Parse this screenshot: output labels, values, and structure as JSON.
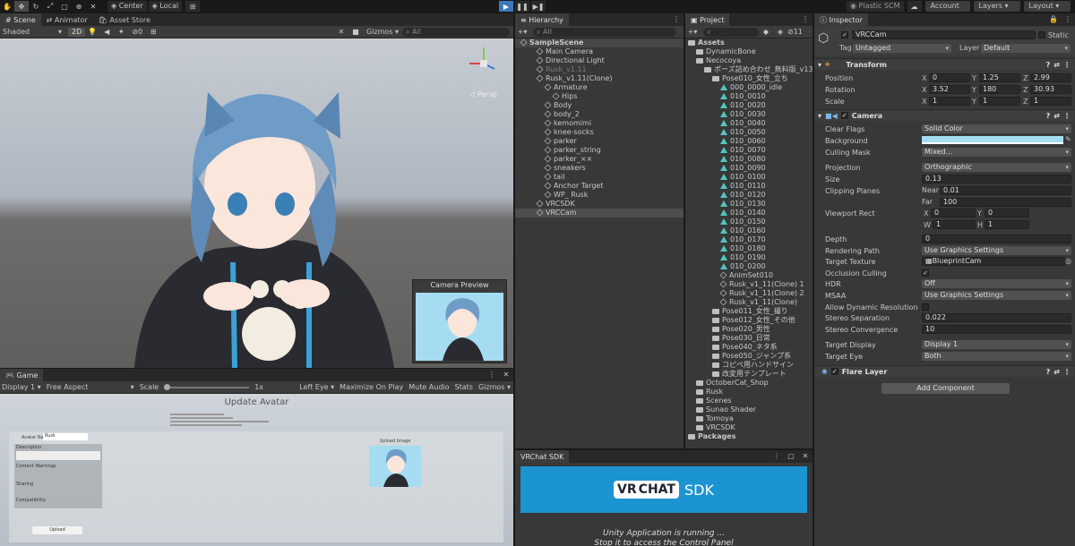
{
  "toolbar": {
    "center_label": "Center",
    "local_label": "Local",
    "plastic_label": "Plastic SCM",
    "account_label": "Account",
    "layers_label": "Layers",
    "layout_label": "Layout"
  },
  "scene": {
    "tabs": [
      "Scene",
      "Animator",
      "Asset Store"
    ],
    "shading": "Shaded",
    "mode_2d": "2D",
    "gizmos": "Gizmos",
    "search_placeholder": "All",
    "hidden_count": "0",
    "persp_label": "Persp",
    "camera_preview_title": "Camera Preview"
  },
  "game": {
    "tab": "Game",
    "display": "Display 1",
    "aspect": "Free Aspect",
    "scale_label": "Scale",
    "scale_value": "1x",
    "eye": "Left Eye",
    "maximize": "Maximize On Play",
    "mute": "Mute Audio",
    "stats": "Stats",
    "gizmos": "Gizmos",
    "upload_title": "Update Avatar",
    "avatar_name_label": "Avatar Name",
    "avatar_name_value": "Rusk",
    "description_label": "Description",
    "content_warnings_label": "Content Warnings",
    "sharing_label": "Sharing",
    "compatibility_label": "Compatibility",
    "upload_image_label": "Upload Image",
    "upload_button": "Upload"
  },
  "hierarchy": {
    "tab": "Hierarchy",
    "search_placeholder": "All",
    "items": [
      {
        "label": "SampleScene",
        "indent": 0,
        "kind": "scene"
      },
      {
        "label": "Main Camera",
        "indent": 2,
        "kind": "obj"
      },
      {
        "label": "Directional Light",
        "indent": 2,
        "kind": "obj"
      },
      {
        "label": "Rusk_v1.11",
        "indent": 2,
        "kind": "dim"
      },
      {
        "label": "Rusk_v1.11(Clone)",
        "indent": 2,
        "kind": "obj"
      },
      {
        "label": "Armature",
        "indent": 3,
        "kind": "obj"
      },
      {
        "label": "Hips",
        "indent": 4,
        "kind": "obj"
      },
      {
        "label": "Body",
        "indent": 3,
        "kind": "obj"
      },
      {
        "label": "body_2",
        "indent": 3,
        "kind": "obj"
      },
      {
        "label": "kemomimi",
        "indent": 3,
        "kind": "obj"
      },
      {
        "label": "knee-socks",
        "indent": 3,
        "kind": "obj"
      },
      {
        "label": "parker",
        "indent": 3,
        "kind": "obj"
      },
      {
        "label": "parker_string",
        "indent": 3,
        "kind": "obj"
      },
      {
        "label": "parker_××",
        "indent": 3,
        "kind": "obj"
      },
      {
        "label": "sneakers",
        "indent": 3,
        "kind": "obj"
      },
      {
        "label": "tail",
        "indent": 3,
        "kind": "obj"
      },
      {
        "label": "Anchor Target",
        "indent": 3,
        "kind": "obj"
      },
      {
        "label": "WP_ Rusk",
        "indent": 3,
        "kind": "obj"
      },
      {
        "label": "VRCSDK",
        "indent": 2,
        "kind": "obj"
      },
      {
        "label": "VRCCam",
        "indent": 2,
        "kind": "selected"
      }
    ]
  },
  "project": {
    "tab": "Project",
    "count": "11",
    "items": [
      {
        "label": "Assets",
        "indent": 0,
        "kind": "folder"
      },
      {
        "label": "DynamicBone",
        "indent": 1,
        "kind": "folder"
      },
      {
        "label": "Necocoya",
        "indent": 1,
        "kind": "folder"
      },
      {
        "label": "ポーズ詰め合わせ_無料版_v130",
        "indent": 2,
        "kind": "folder"
      },
      {
        "label": "Pose010_女性_立ち",
        "indent": 3,
        "kind": "folder"
      },
      {
        "label": "000_0000_idle",
        "indent": 4,
        "kind": "anim"
      },
      {
        "label": "010_0010",
        "indent": 4,
        "kind": "anim"
      },
      {
        "label": "010_0020",
        "indent": 4,
        "kind": "anim"
      },
      {
        "label": "010_0030",
        "indent": 4,
        "kind": "anim"
      },
      {
        "label": "010_0040",
        "indent": 4,
        "kind": "anim"
      },
      {
        "label": "010_0050",
        "indent": 4,
        "kind": "anim"
      },
      {
        "label": "010_0060",
        "indent": 4,
        "kind": "anim"
      },
      {
        "label": "010_0070",
        "indent": 4,
        "kind": "anim"
      },
      {
        "label": "010_0080",
        "indent": 4,
        "kind": "anim"
      },
      {
        "label": "010_0090",
        "indent": 4,
        "kind": "anim"
      },
      {
        "label": "010_0100",
        "indent": 4,
        "kind": "anim"
      },
      {
        "label": "010_0110",
        "indent": 4,
        "kind": "anim"
      },
      {
        "label": "010_0120",
        "indent": 4,
        "kind": "anim"
      },
      {
        "label": "010_0130",
        "indent": 4,
        "kind": "anim"
      },
      {
        "label": "010_0140",
        "indent": 4,
        "kind": "anim"
      },
      {
        "label": "010_0150",
        "indent": 4,
        "kind": "anim"
      },
      {
        "label": "010_0160",
        "indent": 4,
        "kind": "anim"
      },
      {
        "label": "010_0170",
        "indent": 4,
        "kind": "anim"
      },
      {
        "label": "010_0180",
        "indent": 4,
        "kind": "anim"
      },
      {
        "label": "010_0190",
        "indent": 4,
        "kind": "anim"
      },
      {
        "label": "010_0200",
        "indent": 4,
        "kind": "anim"
      },
      {
        "label": "AnimSet010",
        "indent": 4,
        "kind": "asset"
      },
      {
        "label": "Rusk_v1_11(Clone) 1",
        "indent": 4,
        "kind": "asset"
      },
      {
        "label": "Rusk_v1_11(Clone) 2",
        "indent": 4,
        "kind": "asset"
      },
      {
        "label": "Rusk_v1_11(Clone)",
        "indent": 4,
        "kind": "asset"
      },
      {
        "label": "Pose011_女性_撮り",
        "indent": 3,
        "kind": "folder"
      },
      {
        "label": "Pose012_女性_その他",
        "indent": 3,
        "kind": "folder"
      },
      {
        "label": "Pose020_男性",
        "indent": 3,
        "kind": "folder"
      },
      {
        "label": "Pose030_日常",
        "indent": 3,
        "kind": "folder"
      },
      {
        "label": "Pose040_ネタ系",
        "indent": 3,
        "kind": "folder"
      },
      {
        "label": "Pose050_ジャンプ系",
        "indent": 3,
        "kind": "folder"
      },
      {
        "label": "コピペ用ハンドサイン",
        "indent": 3,
        "kind": "folder"
      },
      {
        "label": "改変用テンプレート",
        "indent": 3,
        "kind": "folder"
      },
      {
        "label": "OctoberCat_Shop",
        "indent": 1,
        "kind": "folder"
      },
      {
        "label": "Rusk",
        "indent": 1,
        "kind": "folder"
      },
      {
        "label": "Scenes",
        "indent": 1,
        "kind": "folder"
      },
      {
        "label": "Sunao Shader",
        "indent": 1,
        "kind": "folder"
      },
      {
        "label": "Tomoya",
        "indent": 1,
        "kind": "folder"
      },
      {
        "label": "VRCSDK",
        "indent": 1,
        "kind": "folder"
      },
      {
        "label": "Packages",
        "indent": 0,
        "kind": "folder"
      }
    ]
  },
  "sdk": {
    "tab": "VRChat SDK",
    "logo_vr": "VR",
    "logo_chat": "CHAT",
    "logo_sdk": "SDK",
    "running_line1": "Unity Application is running ...",
    "running_line2": "Stop it to access the Control Panel"
  },
  "inspector": {
    "tab": "Inspector",
    "object_name": "VRCCam",
    "static_label": "Static",
    "tag_label": "Tag",
    "tag_value": "Untagged",
    "layer_label": "Layer",
    "layer_value": "Default",
    "transform_title": "Transform",
    "position_label": "Position",
    "rotation_label": "Rotation",
    "scale_label": "Scale",
    "position": {
      "x": "0",
      "y": "1.25",
      "z": "2.99"
    },
    "rotation": {
      "x": "3.52",
      "y": "180",
      "z": "30.93"
    },
    "scale": {
      "x": "1",
      "y": "1",
      "z": "1"
    },
    "camera_title": "Camera",
    "clear_flags_label": "Clear Flags",
    "clear_flags_value": "Solid Color",
    "background_label": "Background",
    "background_color": "#a5dcf2",
    "culling_mask_label": "Culling Mask",
    "culling_mask_value": "Mixed...",
    "projection_label": "Projection",
    "projection_value": "Orthographic",
    "size_label": "Size",
    "size_value": "0.13",
    "clipping_label": "Clipping Planes",
    "near_label": "Near",
    "near_value": "0.01",
    "far_label": "Far",
    "far_value": "100",
    "viewport_label": "Viewport Rect",
    "viewport": {
      "x": "0",
      "y": "0",
      "w": "1",
      "h": "1"
    },
    "depth_label": "Depth",
    "depth_value": "0",
    "rendering_path_label": "Rendering Path",
    "rendering_path_value": "Use Graphics Settings",
    "target_texture_label": "Target Texture",
    "target_texture_value": "BlueprintCam",
    "occlusion_label": "Occlusion Culling",
    "hdr_label": "HDR",
    "hdr_value": "Off",
    "msaa_label": "MSAA",
    "msaa_value": "Use Graphics Settings",
    "allow_dynres_label": "Allow Dynamic Resolution",
    "stereo_sep_label": "Stereo Separation",
    "stereo_sep_value": "0.022",
    "stereo_conv_label": "Stereo Convergence",
    "stereo_conv_value": "10",
    "target_display_label": "Target Display",
    "target_display_value": "Display 1",
    "target_eye_label": "Target Eye",
    "target_eye_value": "Both",
    "flare_title": "Flare Layer",
    "add_component": "Add Component"
  }
}
